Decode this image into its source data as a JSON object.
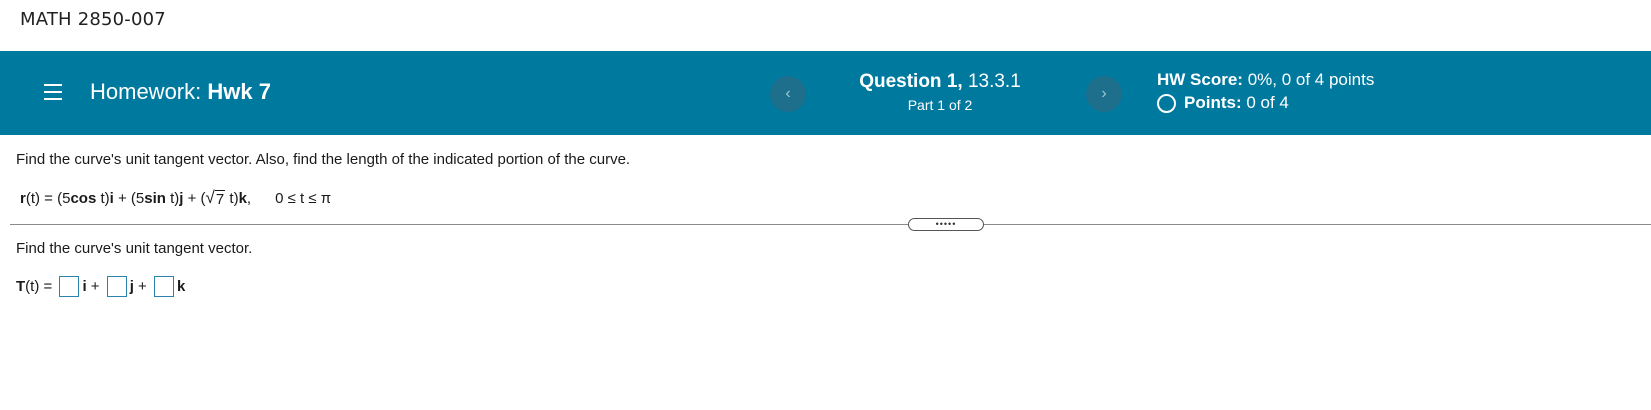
{
  "course": {
    "title": "MATH 2850-007"
  },
  "header": {
    "homework_prefix": "Homework:",
    "homework_name": "Hwk 7",
    "prev_label": "‹",
    "next_label": "›",
    "question_label": "Question 1,",
    "question_section": "13.3.1",
    "part_label": "Part 1 of 2",
    "score_label": "HW Score:",
    "score_value": "0%, 0 of 4 points",
    "points_label": "Points:",
    "points_value": "0 of 4"
  },
  "question": {
    "prompt": "Find the curve's unit tangent vector. Also, find the length of the indicated portion of the curve.",
    "formula": {
      "r": "r",
      "t_open": "(t) = (5",
      "cos": "cos",
      "t_i": " t)",
      "i": "i",
      "plus1": " + (5",
      "sin": "sin",
      "t_j": " t)",
      "j": "j",
      "plus2": " + (",
      "radical": "√",
      "seven": "7",
      "t_k": " t)",
      "k": "k",
      "comma": ",",
      "range": "0 ≤ t ≤ π"
    },
    "expand_label": "•••••",
    "sub_prompt": "Find the curve's unit tangent vector.",
    "answer": {
      "T": "T",
      "t_eq": "(t) = ",
      "i": "i",
      "plus1": " + ",
      "j": "j",
      "plus2": " + ",
      "k": "k"
    }
  }
}
